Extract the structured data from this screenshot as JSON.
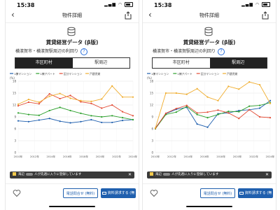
{
  "colors": {
    "brand_blue": "#1f5fae",
    "tab_active": "#222222",
    "series_1k": "#1f5fae",
    "series_2k": "#2ca02c",
    "series_3ldk": "#e34a33",
    "series_family": "#f0ad2e"
  },
  "screens": [
    {
      "status_time": "15:38",
      "nav_title": "物件詳細",
      "section_heading": "賃貸経営データ (β版)",
      "area_line": "横濱賀市・横濱賀駅周辺の利回り",
      "tabs": [
        {
          "label": "市区町村",
          "active": true
        },
        {
          "label": "駅周辺",
          "active": false
        }
      ],
      "toast_text_a": "海辺",
      "toast_text_b": "人が先週に入りに登録しています",
      "btn_phone": "電話問合せ (無料)",
      "btn_request": "資料請求する (無料)",
      "icons": [
        "database-icon",
        "share-icon",
        "help-icon",
        "heart-icon",
        "mail-icon",
        "close-icon"
      ]
    },
    {
      "status_time": "15:38",
      "nav_title": "物件詳細",
      "section_heading": "賃貸経営データ (β版)",
      "area_line": "横濱賀市・横濱賀駅周辺の利回り",
      "tabs": [
        {
          "label": "市区町村",
          "active": false
        },
        {
          "label": "駅周辺",
          "active": true
        }
      ],
      "toast_text_a": "海辺",
      "toast_text_b": "人が先週に入りに登録しています",
      "btn_phone": "電話問合せ (無料)",
      "btn_request": "資料請求する (無料)",
      "icons": [
        "database-icon",
        "share-icon",
        "help-icon",
        "heart-icon",
        "mail-icon",
        "close-icon"
      ]
    }
  ],
  "chart_data": [
    {
      "type": "line",
      "ylabel": "(%)",
      "ylim": [
        0,
        18
      ],
      "yticks": [
        0,
        3,
        6,
        9,
        12,
        15,
        18
      ],
      "x": [
        "2010年",
        "2012年",
        "2014年",
        "2016年",
        "2018年",
        "2020年",
        "2022年",
        "2024年"
      ],
      "grid": true,
      "legend_position": "top-left",
      "series": [
        {
          "name": "1棟マンション",
          "color": "#1f5fae",
          "values": [
            8.0,
            7.8,
            8.2,
            8.6,
            7.9,
            7.5,
            7.8,
            8.3,
            7.6,
            7.6,
            8.1,
            8.3
          ]
        },
        {
          "name": "1棟アパート",
          "color": "#2ca02c",
          "values": [
            10.0,
            9.6,
            9.4,
            10.6,
            11.4,
            10.6,
            9.9,
            9.3,
            9.0,
            9.3,
            8.8,
            8.3
          ]
        },
        {
          "name": "区分マンション",
          "color": "#e34a33",
          "values": [
            11.8,
            12.7,
            12.3,
            14.8,
            13.6,
            14.4,
            12.8,
            12.4,
            11.2,
            12.0,
            10.3,
            9.3
          ]
        },
        {
          "name": "戸建賃貸",
          "color": "#f0ad2e",
          "values": [
            12.2,
            13.4,
            12.7,
            14.2,
            14.9,
            13.7,
            13.1,
            12.9,
            13.5,
            16.8,
            14.0,
            14.0
          ]
        }
      ]
    },
    {
      "type": "line",
      "ylabel": "(%)",
      "ylim": [
        0,
        18
      ],
      "yticks": [
        0,
        3,
        6,
        9,
        12,
        15,
        18
      ],
      "x": [
        "2010年",
        "2012年",
        "2014年",
        "2016年",
        "2018年",
        "2020年",
        "2022年",
        "2024年"
      ],
      "grid": true,
      "legend_position": "top-left",
      "series": [
        {
          "name": "1棟マンション",
          "color": "#1f5fae",
          "values": [
            6.2,
            9.8,
            10.9,
            11.4,
            7.2,
            6.4,
            9.8,
            10.0,
            10.6,
            10.8,
            11.2,
            13.1
          ]
        },
        {
          "name": "1棟アパート",
          "color": "#2ca02c",
          "values": [
            6.0,
            9.6,
            10.2,
            11.6,
            9.6,
            8.8,
            9.6,
            10.4,
            10.3,
            11.7,
            11.9,
            12.6
          ]
        },
        {
          "name": "区分マンション",
          "color": "#e34a33",
          "values": [
            6.1,
            9.9,
            11.1,
            11.9,
            10.0,
            10.2,
            10.7,
            10.0,
            8.6,
            10.8,
            9.0,
            8.8
          ]
        },
        {
          "name": "戸建賃貸",
          "color": "#f0ad2e",
          "values": [
            6.2,
            15.0,
            15.0,
            14.7,
            16.1,
            14.0,
            13.1,
            16.7,
            16.0,
            17.8,
            17.1,
            12.4
          ]
        }
      ]
    }
  ]
}
